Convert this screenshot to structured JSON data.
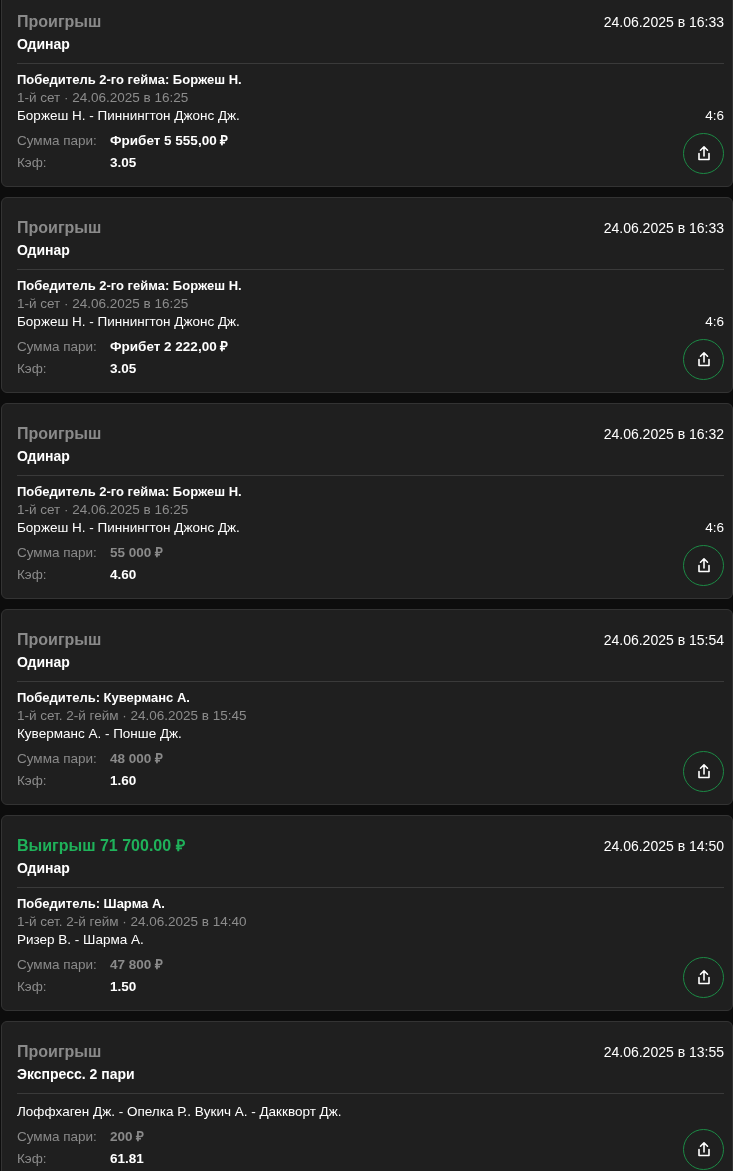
{
  "bets": [
    {
      "result": {
        "kind": "loss",
        "text": "Проигрыш"
      },
      "date": "24.06.2025 в 16:33",
      "type": "Одинар",
      "event": {
        "title": "Победитель 2-го гейма: Боржеш Н.",
        "meta": "1-й сет · 24.06.2025 в 16:25",
        "match": "Боржеш Н. - Пиннингтон Джонс Дж.",
        "score": "4:6"
      },
      "stake_label": "Сумма пари:",
      "stake": {
        "kind": "freebet",
        "text": "Фрибет 5 555,00 ₽"
      },
      "odds_label": "Кэф:",
      "odds": "3.05"
    },
    {
      "result": {
        "kind": "loss",
        "text": "Проигрыш"
      },
      "date": "24.06.2025 в 16:33",
      "type": "Одинар",
      "event": {
        "title": "Победитель 2-го гейма: Боржеш Н.",
        "meta": "1-й сет · 24.06.2025 в 16:25",
        "match": "Боржеш Н. - Пиннингтон Джонс Дж.",
        "score": "4:6"
      },
      "stake_label": "Сумма пари:",
      "stake": {
        "kind": "freebet",
        "text": "Фрибет 2 222,00 ₽"
      },
      "odds_label": "Кэф:",
      "odds": "3.05"
    },
    {
      "result": {
        "kind": "loss",
        "text": "Проигрыш"
      },
      "date": "24.06.2025 в 16:32",
      "type": "Одинар",
      "event": {
        "title": "Победитель 2-го гейма: Боржеш Н.",
        "meta": "1-й сет · 24.06.2025 в 16:25",
        "match": "Боржеш Н. - Пиннингтон Джонс Дж.",
        "score": "4:6"
      },
      "stake_label": "Сумма пари:",
      "stake": {
        "kind": "cash",
        "text": "55 000 ₽"
      },
      "odds_label": "Кэф:",
      "odds": "4.60"
    },
    {
      "result": {
        "kind": "loss",
        "text": "Проигрыш"
      },
      "date": "24.06.2025 в 15:54",
      "type": "Одинар",
      "event": {
        "title": "Победитель: Куверманс А.",
        "meta": "1-й сет. 2-й гейм · 24.06.2025 в 15:45",
        "match": "Куверманс А. - Понше Дж."
      },
      "stake_label": "Сумма пари:",
      "stake": {
        "kind": "cash",
        "text": "48 000 ₽"
      },
      "odds_label": "Кэф:",
      "odds": "1.60"
    },
    {
      "result": {
        "kind": "win",
        "text": "Выигрыш 71 700.00 ₽"
      },
      "date": "24.06.2025 в 14:50",
      "type": "Одинар",
      "event": {
        "title": "Победитель: Шарма А.",
        "meta": "1-й сет. 2-й гейм · 24.06.2025 в 14:40",
        "match": "Ризер В. - Шарма А."
      },
      "stake_label": "Сумма пари:",
      "stake": {
        "kind": "cash",
        "text": "47 800 ₽"
      },
      "odds_label": "Кэф:",
      "odds": "1.50"
    },
    {
      "result": {
        "kind": "loss",
        "text": "Проигрыш"
      },
      "date": "24.06.2025 в 13:55",
      "type": "Экспресс. 2 пари",
      "event": {
        "match": "Лоффхаген Дж. - Опелка Р.. Вукич А. - Даккворт Дж."
      },
      "stake_label": "Сумма пари:",
      "stake": {
        "kind": "cash",
        "text": "200 ₽"
      },
      "odds_label": "Кэф:",
      "odds": "61.81"
    }
  ]
}
